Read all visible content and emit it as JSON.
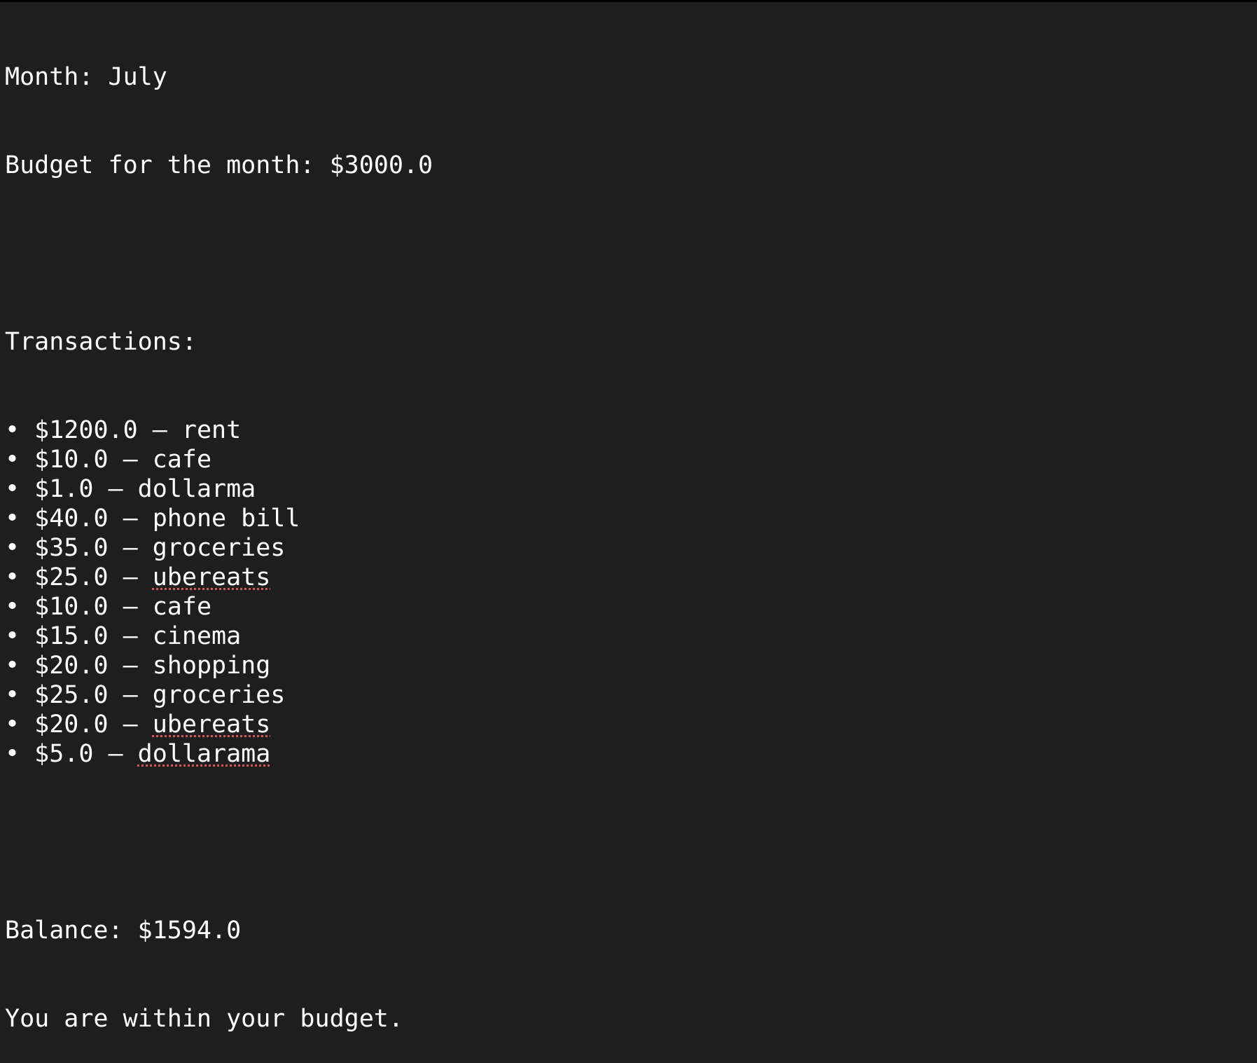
{
  "header": {
    "month_line": "Month: July",
    "budget_line": "Budget for the month: $3000.0"
  },
  "transactions": {
    "heading": "Transactions:",
    "bullet": "•",
    "items": [
      {
        "amount": "$1200.0",
        "sep": " – ",
        "desc": "rent",
        "flagged": false
      },
      {
        "amount": "$10.0",
        "sep": " – ",
        "desc": "cafe",
        "flagged": false
      },
      {
        "amount": "$1.0",
        "sep": " – ",
        "desc": "dollarma",
        "flagged": false
      },
      {
        "amount": "$40.0",
        "sep": " – ",
        "desc": "phone bill",
        "flagged": false
      },
      {
        "amount": "$35.0",
        "sep": " – ",
        "desc": "groceries",
        "flagged": false
      },
      {
        "amount": "$25.0",
        "sep": " – ",
        "desc": "ubereats",
        "flagged": true
      },
      {
        "amount": "$10.0",
        "sep": " – ",
        "desc": "cafe",
        "flagged": false
      },
      {
        "amount": "$15.0",
        "sep": " – ",
        "desc": "cinema",
        "flagged": false
      },
      {
        "amount": "$20.0",
        "sep": " – ",
        "desc": "shopping",
        "flagged": false
      },
      {
        "amount": "$25.0",
        "sep": " – ",
        "desc": "groceries",
        "flagged": false
      },
      {
        "amount": "$20.0",
        "sep": " – ",
        "desc": "ubereats",
        "flagged": true
      },
      {
        "amount": "$5.0",
        "sep": " – ",
        "desc": "dollarama",
        "flagged": true
      }
    ]
  },
  "summary": {
    "balance_line": "Balance: $1594.0",
    "status_line": "You are within your budget."
  },
  "colors": {
    "background": "#1e1e1e",
    "text": "#ffffff",
    "spellcheck": "#d9534f"
  }
}
